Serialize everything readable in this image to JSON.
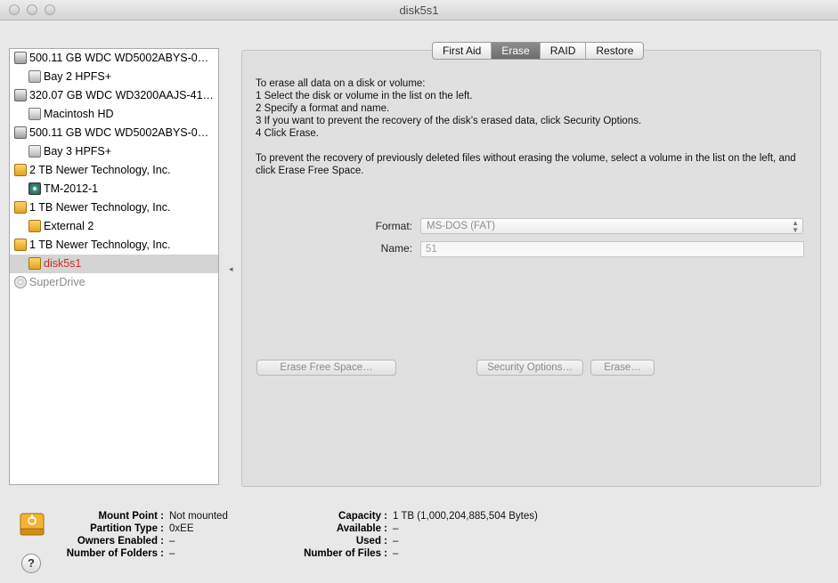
{
  "window": {
    "title": "disk5s1"
  },
  "sidebar": {
    "items": [
      {
        "label": "500.11 GB WDC WD5002ABYS-0…",
        "icon": "internal-disk-icon"
      },
      {
        "label": "Bay 2 HPFS+",
        "icon": "volume-icon"
      },
      {
        "label": "320.07 GB WDC WD3200AAJS-41…",
        "icon": "internal-disk-icon"
      },
      {
        "label": "Macintosh HD",
        "icon": "volume-icon"
      },
      {
        "label": "500.11 GB WDC WD5002ABYS-0…",
        "icon": "internal-disk-icon"
      },
      {
        "label": "Bay 3 HPFS+",
        "icon": "volume-icon"
      },
      {
        "label": "2 TB Newer Technology, Inc.",
        "icon": "external-disk-icon"
      },
      {
        "label": "TM-2012-1",
        "icon": "time-machine-icon"
      },
      {
        "label": "1 TB Newer Technology, Inc.",
        "icon": "external-disk-icon"
      },
      {
        "label": "External 2",
        "icon": "external-volume-icon"
      },
      {
        "label": "1 TB Newer Technology, Inc.",
        "icon": "external-disk-icon"
      },
      {
        "label": "disk5s1",
        "icon": "external-volume-icon"
      },
      {
        "label": "SuperDrive",
        "icon": "optical-drive-icon"
      }
    ]
  },
  "tabs": [
    {
      "label": "First Aid"
    },
    {
      "label": "Erase"
    },
    {
      "label": "RAID"
    },
    {
      "label": "Restore"
    }
  ],
  "erase": {
    "instructions": [
      "To erase all data on a disk or volume:",
      "1 Select the disk or volume in the list on the left.",
      "2 Specify a format and name.",
      "3 If you want to prevent the recovery of the disk’s erased data, click Security Options.",
      "4 Click Erase."
    ],
    "free_space_note": "To prevent the recovery of previously deleted files without erasing the volume, select a volume in the list on the left, and click Erase Free Space.",
    "format_label": "Format:",
    "format_value": "MS-DOS (FAT)",
    "name_label": "Name:",
    "name_value": "51",
    "erase_free_space_button": "Erase Free Space…",
    "security_options_button": "Security Options…",
    "erase_button": "Erase…"
  },
  "info": {
    "left": [
      {
        "key": "Mount Point :",
        "value": "Not mounted"
      },
      {
        "key": "Partition Type :",
        "value": "0xEE"
      },
      {
        "key": "Owners Enabled :",
        "value": "–"
      },
      {
        "key": "Number of Folders :",
        "value": "–"
      }
    ],
    "right": [
      {
        "key": "Capacity :",
        "value": "1 TB (1,000,204,885,504 Bytes)"
      },
      {
        "key": "Available :",
        "value": "–"
      },
      {
        "key": "Used :",
        "value": "–"
      },
      {
        "key": "Number of Files :",
        "value": "–"
      }
    ]
  },
  "help": {
    "label": "?"
  }
}
